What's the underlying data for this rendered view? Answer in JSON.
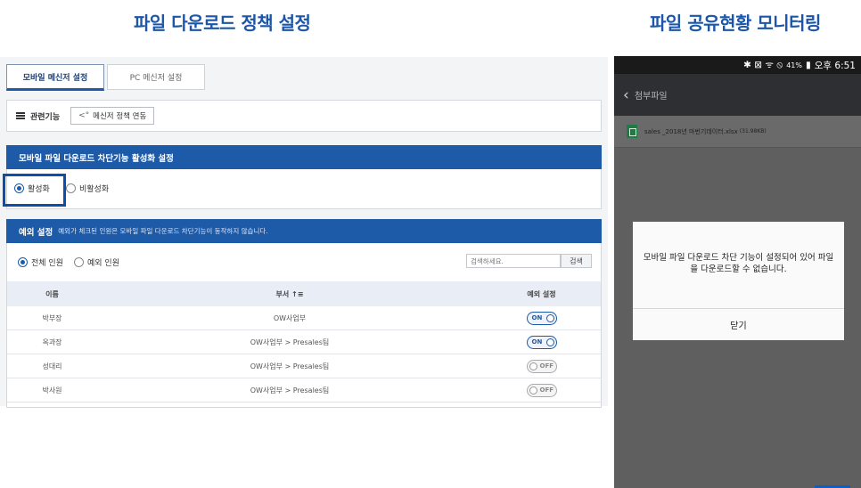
{
  "headings": {
    "left": "파일 다운로드 정책 설정",
    "right": "파일 공유현황 모니터링"
  },
  "tabs": [
    {
      "label": "모바일 메신저 설정",
      "active": true
    },
    {
      "label": "PC 메신저 설정",
      "active": false
    }
  ],
  "related": {
    "label": "관련기능",
    "policy_button": "메신저 정책 연동"
  },
  "section1": {
    "title": "모바일 파일 다운로드 차단기능 활성화 설정",
    "options": [
      {
        "label": "활성화",
        "checked": true
      },
      {
        "label": "비활성화",
        "checked": false
      }
    ]
  },
  "section2": {
    "title": "예외 설정",
    "subtitle": "예외가 체크된 인원은 모바일 파일 다운로드 차단기능이 동작하지 않습니다.",
    "options": [
      {
        "label": "전체 인원",
        "checked": true
      },
      {
        "label": "예외 인원",
        "checked": false
      }
    ],
    "search": {
      "placeholder": "검색하세요.",
      "button": "검색"
    },
    "columns": [
      "이름",
      "부서 ↑≡",
      "예외 설정"
    ],
    "rows": [
      {
        "name": "박부장",
        "dept": "OW사업부",
        "toggle": "ON"
      },
      {
        "name": "옥과장",
        "dept": "OW사업부 > Presales팀",
        "toggle": "ON"
      },
      {
        "name": "성대리",
        "dept": "OW사업부 > Presales팀",
        "toggle": "OFF"
      },
      {
        "name": "박사원",
        "dept": "OW사업부 > Presales팀",
        "toggle": "OFF"
      }
    ]
  },
  "phone": {
    "status": {
      "icons": "✱ ⊠ ᯤ ⦸",
      "battery": "41%",
      "time": "오후 6:51"
    },
    "appbar_title": "첨부파일",
    "file": {
      "name": "sales _2018년 마번기데이터.xlsx",
      "size": "(31.98KB)"
    },
    "dialog": {
      "message": "모바일 파일 다운로드 차단 기능이 설정되어 있어 파일을 다운로드할 수 없습니다.",
      "button": "닫기"
    }
  },
  "colors": {
    "accent": "#1d5aa8",
    "heading": "#1c56a8",
    "phone_bg": "#5f5f5f"
  }
}
